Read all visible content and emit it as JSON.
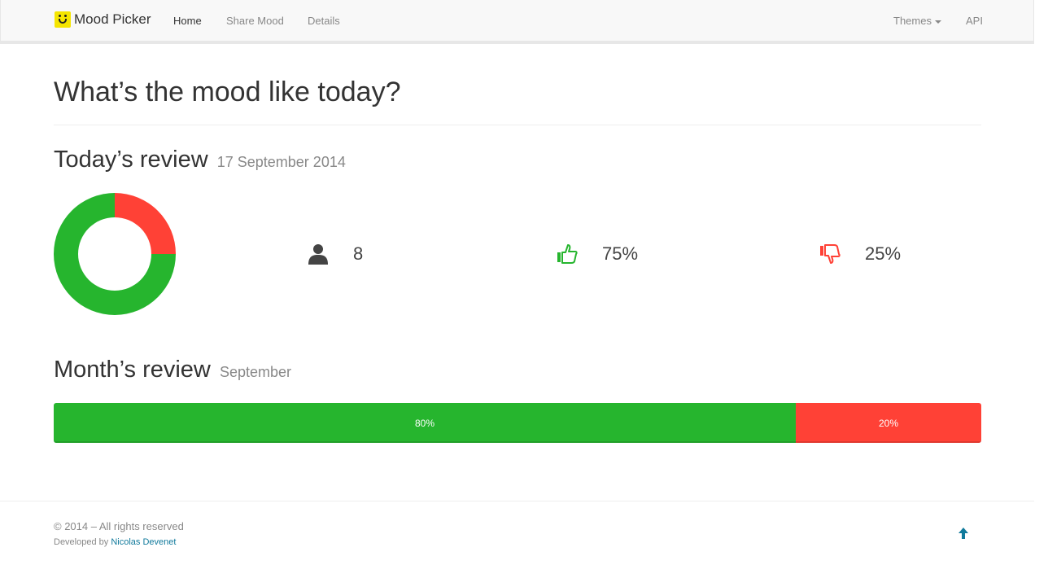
{
  "navbar": {
    "brand": "Mood Picker",
    "links": [
      "Home",
      "Share Mood",
      "Details"
    ],
    "themes_label": "Themes",
    "api_label": "API"
  },
  "page": {
    "title": "What’s the mood like today?"
  },
  "today": {
    "heading": "Today’s review",
    "date": "17 September 2014",
    "participants": "8",
    "positive_pct": "75%",
    "negative_pct": "25%",
    "positive_fraction": 0.75,
    "negative_fraction": 0.25
  },
  "month": {
    "heading": "Month’s review",
    "month_name": "September",
    "positive_label": "80%",
    "negative_label": "20%",
    "positive_fraction": 0.8,
    "negative_fraction": 0.2
  },
  "footer": {
    "copyright": "© 2014 – All rights reserved",
    "developed_by": "Developed by",
    "author": "Nicolas Devenet"
  },
  "colors": {
    "positive": "#26b52e",
    "negative": "#ff4136",
    "link": "#117a9c",
    "brand_logo": "#f5e500"
  },
  "icons": {
    "participants": "user-icon",
    "positive": "thumbs-up-icon",
    "negative": "thumbs-down-icon",
    "back_to_top": "arrow-up-icon"
  }
}
